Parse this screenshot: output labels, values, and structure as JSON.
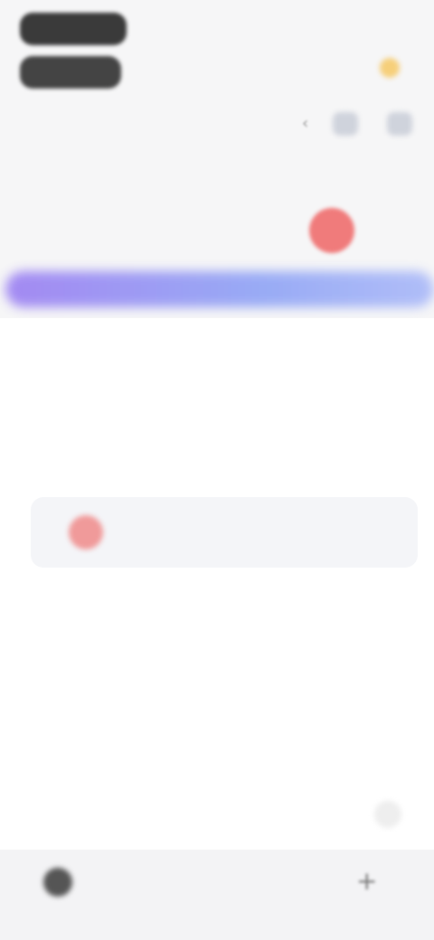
{
  "header": {
    "logo_line_1": "",
    "logo_line_2": "",
    "logo_subtitle": "",
    "top_right_text": "",
    "week_text": "",
    "weather_icon": "sun-icon",
    "nav_prev_icon": "chevron-left-icon"
  },
  "week": {
    "days": [
      {
        "label": "",
        "num": ""
      },
      {
        "label": "",
        "num": ""
      },
      {
        "label": "",
        "num": ""
      },
      {
        "label": "",
        "num": ""
      },
      {
        "label": "",
        "num": ""
      },
      {
        "label": "",
        "num": "",
        "today": true
      },
      {
        "label": "",
        "num": ""
      }
    ],
    "accent_color": "#f07b7b"
  },
  "banner": {
    "gradient_start": "#9a7ef2",
    "gradient_end": "#a9b8f8"
  },
  "content": {
    "section_a_title": "",
    "empty_note": "",
    "section_b_title": "",
    "event": {
      "title": "",
      "subtitle": "",
      "dot_color": "#f09a9a"
    }
  },
  "bottom_bar": {
    "text": "",
    "plus": "+"
  }
}
